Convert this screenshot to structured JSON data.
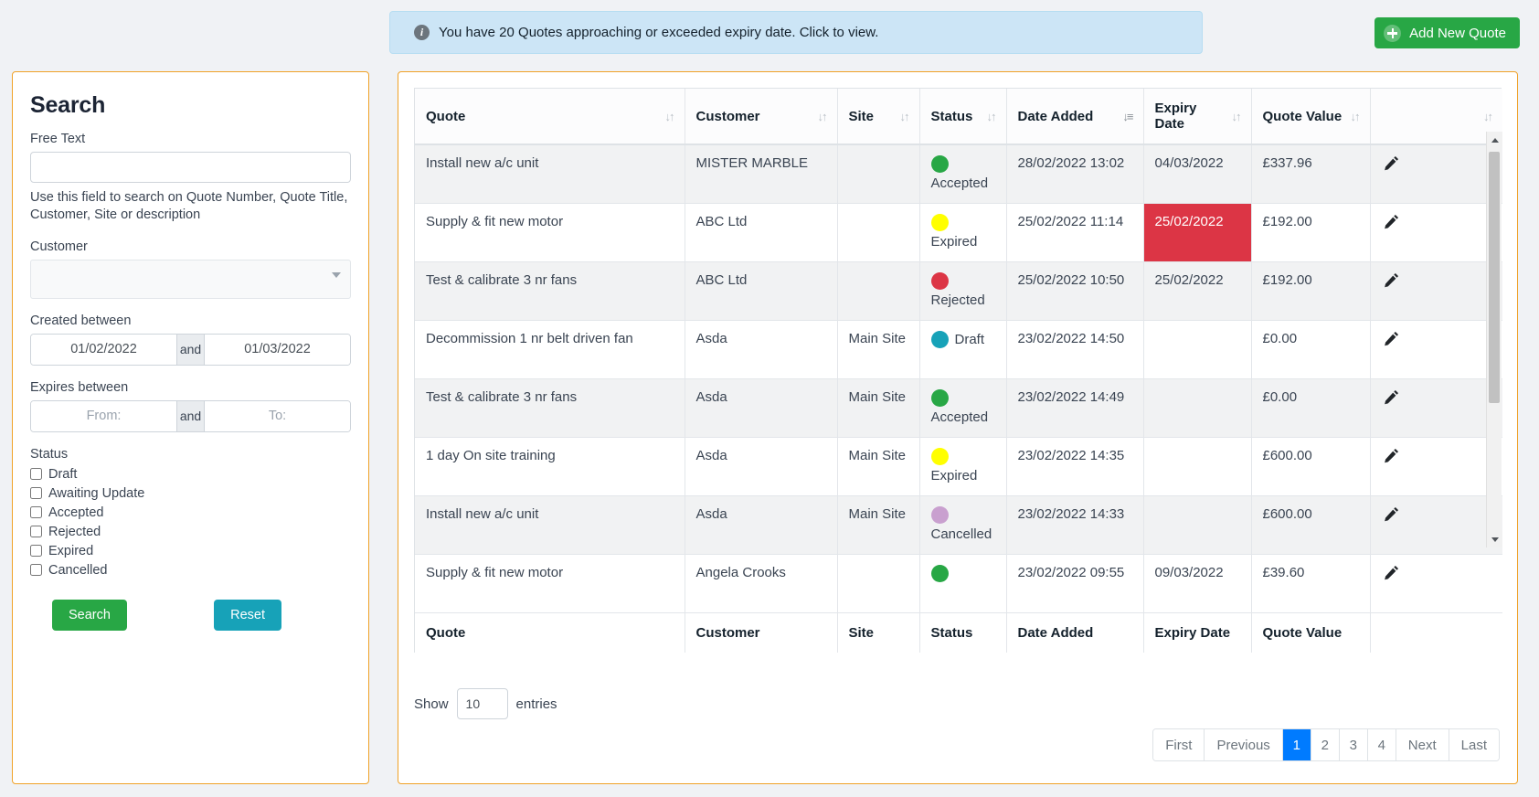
{
  "alert": {
    "icon": "info-icon",
    "text": "You have 20 Quotes approaching or exceeded expiry date. Click to view."
  },
  "add_quote_button": {
    "label": "Add New Quote",
    "icon": "plus-circle-icon",
    "color": "#28a745"
  },
  "search_panel": {
    "title": "Search",
    "free_text": {
      "label": "Free Text",
      "value": "",
      "placeholder": ""
    },
    "helper_text": "Use this field to search on Quote Number, Quote Title, Customer, Site or description",
    "customer": {
      "label": "Customer",
      "value": ""
    },
    "created_between": {
      "label": "Created between",
      "from": "01/02/2022",
      "and": "and",
      "to": "01/03/2022"
    },
    "expires_between": {
      "label": "Expires between",
      "from": "",
      "from_placeholder": "From:",
      "and": "and",
      "to": "",
      "to_placeholder": "To:"
    },
    "status": {
      "label": "Status",
      "options": [
        {
          "label": "Draft",
          "checked": false
        },
        {
          "label": "Awaiting Update",
          "checked": false
        },
        {
          "label": "Accepted",
          "checked": false
        },
        {
          "label": "Rejected",
          "checked": false
        },
        {
          "label": "Expired",
          "checked": false
        },
        {
          "label": "Cancelled",
          "checked": false
        }
      ]
    },
    "buttons": {
      "search": {
        "label": "Search",
        "color": "#28a745"
      },
      "reset": {
        "label": "Reset",
        "color": "#17a2b8"
      }
    }
  },
  "table": {
    "columns": [
      {
        "label": "Quote",
        "sort": "none"
      },
      {
        "label": "Customer",
        "sort": "none"
      },
      {
        "label": "Site",
        "sort": "none"
      },
      {
        "label": "Status",
        "sort": "none"
      },
      {
        "label": "Date Added",
        "sort": "desc"
      },
      {
        "label": "Expiry Date",
        "sort": "none"
      },
      {
        "label": "Quote Value",
        "sort": "none"
      },
      {
        "label": "",
        "sort": "none"
      }
    ],
    "footer_columns": [
      "Quote",
      "Customer",
      "Site",
      "Status",
      "Date Added",
      "Expiry Date",
      "Quote Value",
      ""
    ],
    "status_colors": {
      "Accepted": "#28a745",
      "Expired": "#ffff00",
      "Rejected": "#dc3545",
      "Draft": "#17a2b8",
      "Cancelled": "#c9a0cf",
      "expiry_highlight": "#dc3545"
    },
    "rows": [
      {
        "quote": "Install new a/c unit",
        "customer": "MISTER MARBLE",
        "site": "",
        "status": "Accepted",
        "status_color": "#28a745",
        "status_inline": false,
        "date_added": "28/02/2022 13:02",
        "expiry": "04/03/2022",
        "expiry_alert": false,
        "value": "£337.96",
        "edit_icon": "pencil-icon"
      },
      {
        "quote": "Supply & fit new motor",
        "customer": "ABC Ltd",
        "site": "",
        "status": "Expired",
        "status_color": "#ffff00",
        "status_inline": false,
        "date_added": "25/02/2022 11:14",
        "expiry": "25/02/2022",
        "expiry_alert": true,
        "value": "£192.00",
        "edit_icon": "pencil-icon"
      },
      {
        "quote": "Test & calibrate 3 nr fans",
        "customer": "ABC Ltd",
        "site": "",
        "status": "Rejected",
        "status_color": "#dc3545",
        "status_inline": false,
        "date_added": "25/02/2022 10:50",
        "expiry": "25/02/2022",
        "expiry_alert": false,
        "value": "£192.00",
        "edit_icon": "pencil-icon"
      },
      {
        "quote": "Decommission 1 nr belt driven fan",
        "customer": "Asda",
        "site": "Main Site",
        "status": "Draft",
        "status_color": "#17a2b8",
        "status_inline": true,
        "date_added": "23/02/2022 14:50",
        "expiry": "",
        "expiry_alert": false,
        "value": "£0.00",
        "edit_icon": "pencil-icon"
      },
      {
        "quote": "Test & calibrate 3 nr fans",
        "customer": "Asda",
        "site": "Main Site",
        "status": "Accepted",
        "status_color": "#28a745",
        "status_inline": false,
        "date_added": "23/02/2022 14:49",
        "expiry": "",
        "expiry_alert": false,
        "value": "£0.00",
        "edit_icon": "pencil-icon"
      },
      {
        "quote": "1 day On site training",
        "customer": "Asda",
        "site": "Main Site",
        "status": "Expired",
        "status_color": "#ffff00",
        "status_inline": false,
        "date_added": "23/02/2022 14:35",
        "expiry": "",
        "expiry_alert": false,
        "value": "£600.00",
        "edit_icon": "pencil-icon"
      },
      {
        "quote": "Install new a/c unit",
        "customer": "Asda",
        "site": "Main Site",
        "status": "Cancelled",
        "status_color": "#c9a0cf",
        "status_inline": false,
        "date_added": "23/02/2022 14:33",
        "expiry": "",
        "expiry_alert": false,
        "value": "£600.00",
        "edit_icon": "pencil-icon"
      },
      {
        "quote": "Supply & fit new motor",
        "customer": "Angela Crooks",
        "site": "",
        "status": "",
        "status_color": "#28a745",
        "status_inline": false,
        "date_added": "23/02/2022 09:55",
        "expiry": "09/03/2022",
        "expiry_alert": false,
        "value": "£39.60",
        "edit_icon": "pencil-icon"
      }
    ]
  },
  "footer": {
    "show_label": "Show",
    "entries_value": "10",
    "entries_label": "entries",
    "pagination": [
      {
        "label": "First",
        "active": false
      },
      {
        "label": "Previous",
        "active": false
      },
      {
        "label": "1",
        "active": true
      },
      {
        "label": "2",
        "active": false
      },
      {
        "label": "3",
        "active": false
      },
      {
        "label": "4",
        "active": false
      },
      {
        "label": "Next",
        "active": false
      },
      {
        "label": "Last",
        "active": false
      }
    ]
  }
}
